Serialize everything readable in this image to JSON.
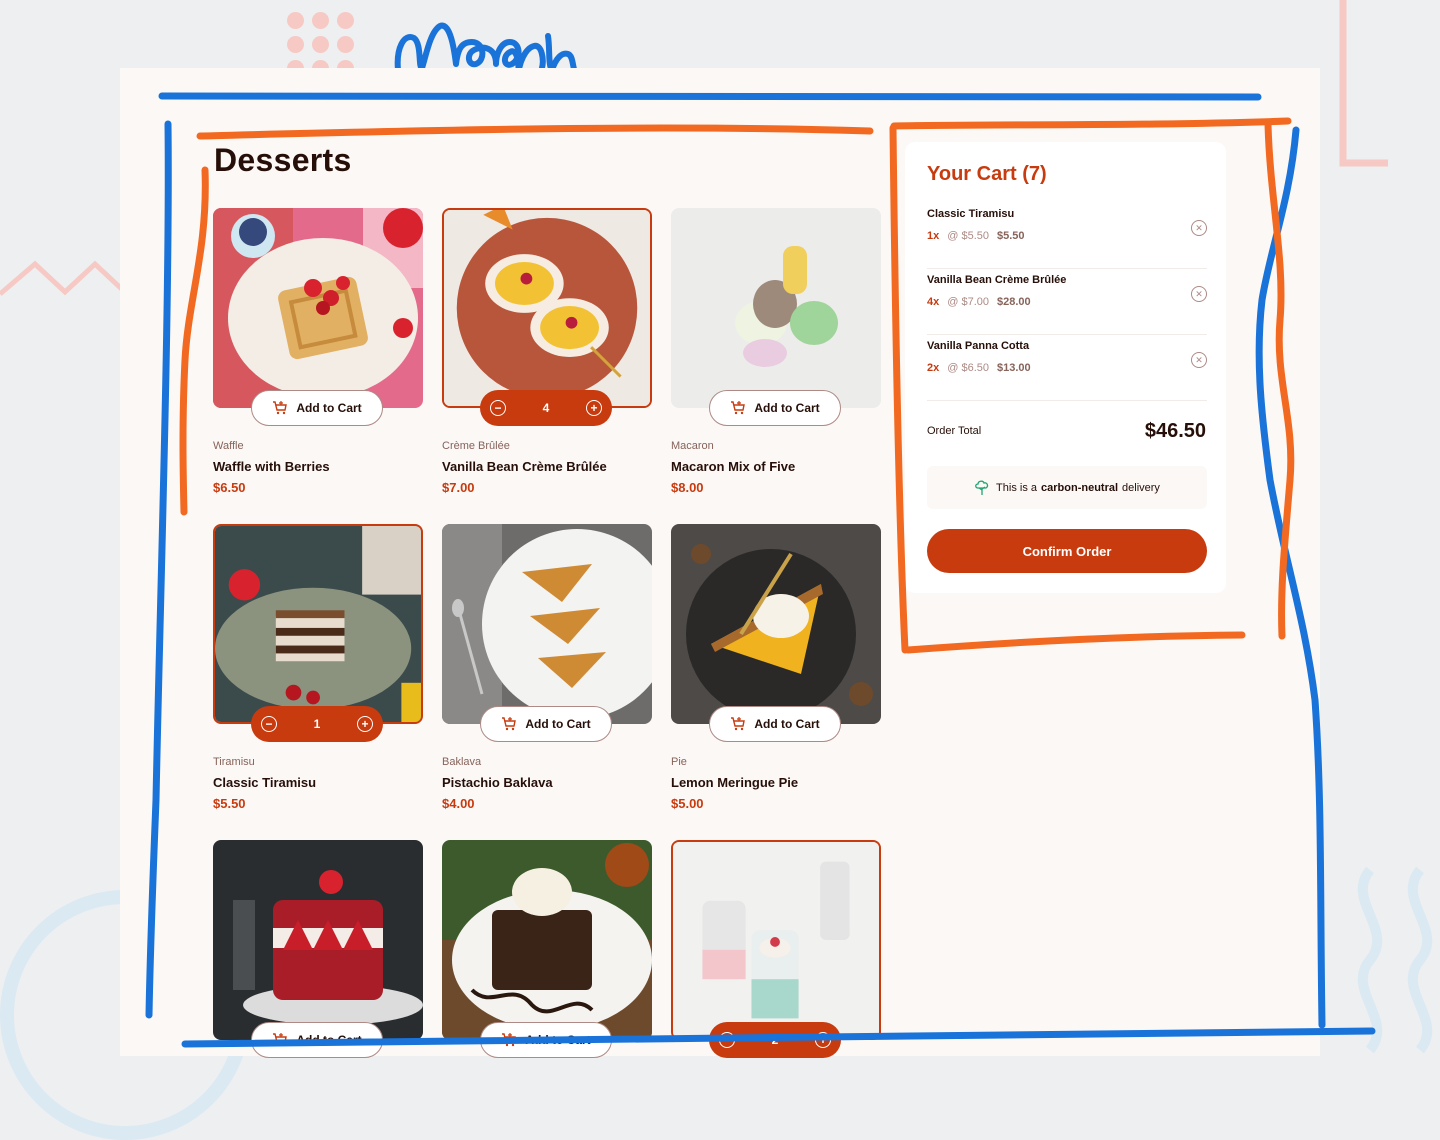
{
  "page": {
    "title": "Desserts"
  },
  "colors": {
    "accent": "#c73b0f",
    "text_dark": "#260f08",
    "muted": "#87635a",
    "rose": "#ad8a85",
    "annotation_blue": "#1a73d9",
    "annotation_orange": "#f26a21"
  },
  "scribble": {
    "text": "main"
  },
  "products": [
    {
      "category": "Waffle",
      "name": "Waffle with Berries",
      "price": "$6.50",
      "in_cart": false,
      "quantity": "",
      "add_label": "Add to Cart"
    },
    {
      "category": "Crème Brûlée",
      "name": "Vanilla Bean Crème Brûlée",
      "price": "$7.00",
      "in_cart": true,
      "quantity": "4",
      "add_label": "Add to Cart"
    },
    {
      "category": "Macaron",
      "name": "Macaron Mix of Five",
      "price": "$8.00",
      "in_cart": false,
      "quantity": "",
      "add_label": "Add to Cart"
    },
    {
      "category": "Tiramisu",
      "name": "Classic Tiramisu",
      "price": "$5.50",
      "in_cart": true,
      "quantity": "1",
      "add_label": "Add to Cart"
    },
    {
      "category": "Baklava",
      "name": "Pistachio Baklava",
      "price": "$4.00",
      "in_cart": false,
      "quantity": "",
      "add_label": "Add to Cart"
    },
    {
      "category": "Pie",
      "name": "Lemon Meringue Pie",
      "price": "$5.00",
      "in_cart": false,
      "quantity": "",
      "add_label": "Add to Cart"
    },
    {
      "category": "",
      "name": "",
      "price": "",
      "in_cart": false,
      "quantity": "",
      "add_label": "Add to Cart"
    },
    {
      "category": "",
      "name": "",
      "price": "",
      "in_cart": false,
      "quantity": "",
      "add_label": "Add to Cart"
    },
    {
      "category": "",
      "name": "",
      "price": "",
      "in_cart": true,
      "quantity": "2",
      "add_label": ""
    }
  ],
  "cart": {
    "title": "Your Cart (7)",
    "items": [
      {
        "name": "Classic Tiramisu",
        "qty": "1x",
        "unit": "@ $5.50",
        "total": "$5.50"
      },
      {
        "name": "Vanilla Bean Crème Brûlée",
        "qty": "4x",
        "unit": "@ $7.00",
        "total": "$28.00"
      },
      {
        "name": "Vanilla Panna Cotta",
        "qty": "2x",
        "unit": "@ $6.50",
        "total": "$13.00"
      }
    ],
    "order_total_label": "Order Total",
    "order_total": "$46.50",
    "carbon_prefix": "This is a",
    "carbon_bold": "carbon-neutral",
    "carbon_suffix": "delivery",
    "confirm_label": "Confirm Order"
  }
}
